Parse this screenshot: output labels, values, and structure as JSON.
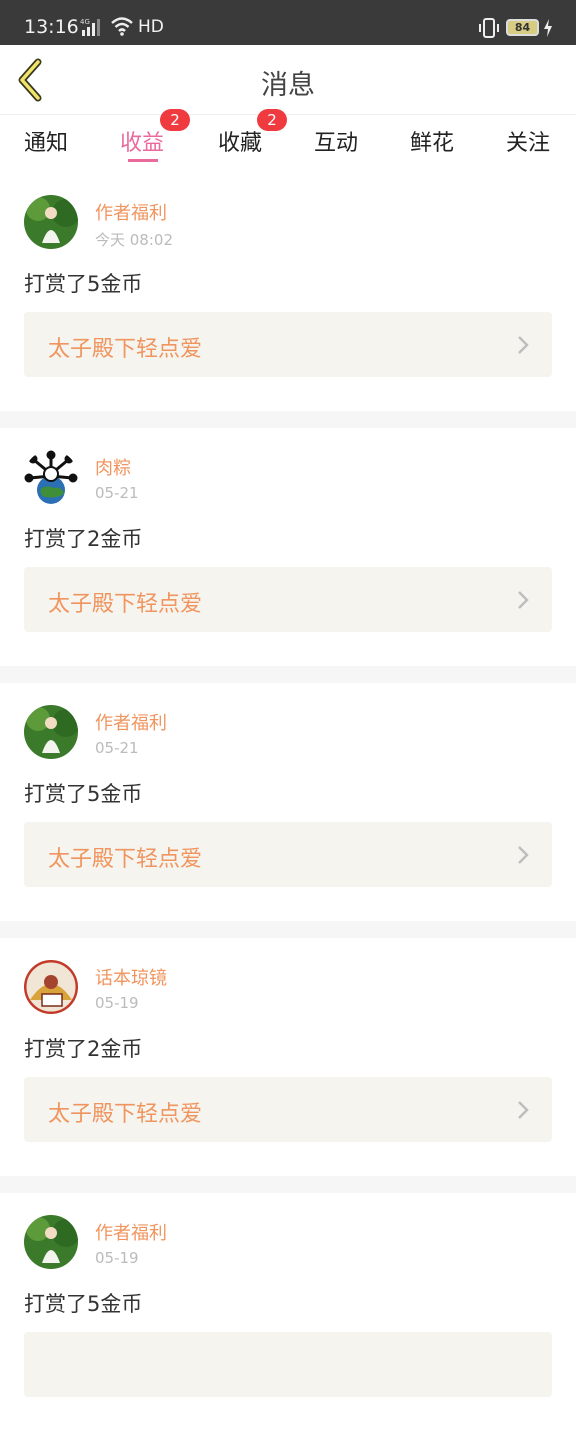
{
  "status": {
    "time": "13:16",
    "network": "HD",
    "battery": "84"
  },
  "header": {
    "title": "消息",
    "back_icon": "chevron-left-icon"
  },
  "tabs": [
    {
      "label": "通知",
      "badge": ""
    },
    {
      "label": "收益",
      "badge": "2",
      "active": true
    },
    {
      "label": "收藏",
      "badge": "2"
    },
    {
      "label": "互动",
      "badge": ""
    },
    {
      "label": "鲜花",
      "badge": ""
    },
    {
      "label": "关注",
      "badge": ""
    }
  ],
  "messages": [
    {
      "name": "作者福利",
      "time": "今天 08:02",
      "desc": "打赏了5金币",
      "book": "太子殿下轻点爱",
      "avatar": "girl-forest"
    },
    {
      "name": "肉粽",
      "time": "05-21",
      "desc": "打赏了2金币",
      "book": "太子殿下轻点爱",
      "avatar": "earth-bones"
    },
    {
      "name": "作者福利",
      "time": "05-21",
      "desc": "打赏了5金币",
      "book": "太子殿下轻点爱",
      "avatar": "girl-forest"
    },
    {
      "name": "话本琼镜",
      "time": "05-19",
      "desc": "打赏了2金币",
      "book": "太子殿下轻点爱",
      "avatar": "stage-red"
    },
    {
      "name": "作者福利",
      "time": "05-19",
      "desc": "打赏了5金币",
      "book": "",
      "avatar": "girl-forest"
    }
  ],
  "colors": {
    "accent": "#e86b9c",
    "name": "#f0955f",
    "badge": "#ef3b40",
    "book_bg": "#f5f4ee"
  }
}
